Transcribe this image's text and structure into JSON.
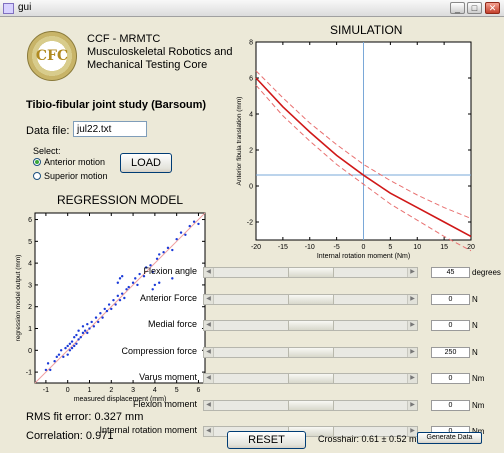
{
  "window": {
    "title": "gui"
  },
  "org": {
    "logo_text": "CFC",
    "line1": "CCF - MRMTC",
    "line2": "Musculoskeletal Robotics and",
    "line3": "Mechanical Testing Core"
  },
  "study_title": "Tibio-fibular joint study (Barsoum)",
  "data_file": {
    "label": "Data file:",
    "value": "jul22.txt"
  },
  "select": {
    "label": "Select:",
    "options": [
      {
        "label": "Anterior motion",
        "selected": true
      },
      {
        "label": "Superior motion",
        "selected": false
      }
    ]
  },
  "buttons": {
    "load": "LOAD",
    "reset": "RESET",
    "generate": "Generate Data"
  },
  "regression": {
    "heading": "REGRESSION MODEL",
    "rms_label": "RMS fit error:  0.327 mm",
    "correlation_label": "Correlation: 0.971"
  },
  "simulation": {
    "heading": "SIMULATION"
  },
  "sliders": [
    {
      "label": "Flexion angle",
      "value": "45",
      "unit": "degrees",
      "position": 0.5
    },
    {
      "label": "Anterior Force",
      "value": "0",
      "unit": "N",
      "position": 0.5
    },
    {
      "label": "Medial force",
      "value": "0",
      "unit": "N",
      "position": 0.5
    },
    {
      "label": "Compression force",
      "value": "250",
      "unit": "N",
      "position": 0.5
    },
    {
      "label": "Varus moment",
      "value": "0",
      "unit": "Nm",
      "position": 0.5
    },
    {
      "label": "Flexion moment",
      "value": "0",
      "unit": "Nm",
      "position": 0.5
    },
    {
      "label": "Internal rotation moment",
      "value": "0",
      "unit": "Nm",
      "position": 0.5
    }
  ],
  "crosshair": {
    "text": "Crosshair:  0.61 ±   0.52 mm"
  },
  "colors": {
    "scatter": "#1a3ad8",
    "fit_line": "#f0a0a0",
    "sim_main": "#d01818",
    "sim_band": "#e87070",
    "crosshair": "#7aa8d8"
  },
  "chart_data": [
    {
      "type": "scatter",
      "title": "",
      "xlabel": "measured displacement (mm)",
      "ylabel": "regression model output (mm)",
      "xlim": [
        -1.5,
        6.3
      ],
      "ylim": [
        -1.5,
        6.3
      ],
      "xticks": [
        "-1",
        "0",
        "1",
        "2",
        "3",
        "4",
        "5",
        "6"
      ],
      "yticks": [
        "-1",
        "0",
        "1",
        "2",
        "3",
        "4",
        "5",
        "6"
      ],
      "reference_line": {
        "x": [
          -1.5,
          6.3
        ],
        "y": [
          -1.5,
          6.3
        ]
      },
      "points": [
        [
          -1.0,
          -0.9
        ],
        [
          -0.9,
          -0.6
        ],
        [
          -0.8,
          -0.9
        ],
        [
          -0.6,
          -0.5
        ],
        [
          -0.5,
          -0.3
        ],
        [
          -0.4,
          -0.2
        ],
        [
          -0.3,
          0.0
        ],
        [
          -0.2,
          -0.3
        ],
        [
          -0.1,
          0.1
        ],
        [
          0.0,
          0.2
        ],
        [
          0.0,
          -0.2
        ],
        [
          0.1,
          0.3
        ],
        [
          0.1,
          0.0
        ],
        [
          0.2,
          0.4
        ],
        [
          0.2,
          0.1
        ],
        [
          0.3,
          0.2
        ],
        [
          0.3,
          0.6
        ],
        [
          0.4,
          0.3
        ],
        [
          0.4,
          0.7
        ],
        [
          0.5,
          0.5
        ],
        [
          0.5,
          0.9
        ],
        [
          0.6,
          0.6
        ],
        [
          0.7,
          0.8
        ],
        [
          0.7,
          1.1
        ],
        [
          0.8,
          0.9
        ],
        [
          0.9,
          1.2
        ],
        [
          0.9,
          0.8
        ],
        [
          1.0,
          1.0
        ],
        [
          1.1,
          1.3
        ],
        [
          1.2,
          1.1
        ],
        [
          1.3,
          1.5
        ],
        [
          1.4,
          1.3
        ],
        [
          1.5,
          1.7
        ],
        [
          1.6,
          1.5
        ],
        [
          1.7,
          1.9
        ],
        [
          1.8,
          1.8
        ],
        [
          1.9,
          2.1
        ],
        [
          2.0,
          1.9
        ],
        [
          2.1,
          2.3
        ],
        [
          2.2,
          2.1
        ],
        [
          2.3,
          2.5
        ],
        [
          2.4,
          2.3
        ],
        [
          2.5,
          2.6
        ],
        [
          2.6,
          2.4
        ],
        [
          2.7,
          2.8
        ],
        [
          2.8,
          2.9
        ],
        [
          3.0,
          3.1
        ],
        [
          3.1,
          3.3
        ],
        [
          3.2,
          3.0
        ],
        [
          3.3,
          3.5
        ],
        [
          3.5,
          3.4
        ],
        [
          3.6,
          3.8
        ],
        [
          3.8,
          3.9
        ],
        [
          3.9,
          3.6
        ],
        [
          4.1,
          4.2
        ],
        [
          4.2,
          4.4
        ],
        [
          4.4,
          4.5
        ],
        [
          4.6,
          4.7
        ],
        [
          4.8,
          4.6
        ],
        [
          5.0,
          5.1
        ],
        [
          5.2,
          5.4
        ],
        [
          5.4,
          5.3
        ],
        [
          5.6,
          5.7
        ],
        [
          5.8,
          5.9
        ],
        [
          6.0,
          5.8
        ],
        [
          2.3,
          3.1
        ],
        [
          2.4,
          3.3
        ],
        [
          2.5,
          3.4
        ],
        [
          3.9,
          2.8
        ],
        [
          4.0,
          3.0
        ],
        [
          4.2,
          3.1
        ],
        [
          4.8,
          3.3
        ]
      ]
    },
    {
      "type": "line",
      "title": "",
      "xlabel": "Internal rotation moment (Nm)",
      "ylabel": "Anterior fibula translation (mm)",
      "xlim": [
        -20,
        20
      ],
      "ylim": [
        -3,
        8
      ],
      "xticks": [
        "-20",
        "-15",
        "-10",
        "-5",
        "0",
        "5",
        "10",
        "15",
        "20"
      ],
      "yticks": [
        "-2",
        "0",
        "2",
        "4",
        "6",
        "8"
      ],
      "crosshair": {
        "x": 0,
        "y": 0.61
      },
      "series": [
        {
          "x": [
            -20,
            -15,
            -10,
            -5,
            0,
            5,
            10,
            15,
            20
          ],
          "y": [
            6.0,
            4.4,
            3.0,
            1.7,
            0.6,
            -0.4,
            -1.2,
            -2.0,
            -2.8
          ],
          "style": "solid"
        },
        {
          "x": [
            -20,
            -15,
            -10,
            -5,
            0,
            5,
            10,
            15,
            20
          ],
          "y": [
            6.4,
            4.9,
            3.5,
            2.3,
            1.2,
            0.3,
            -0.5,
            -1.2,
            -1.8
          ],
          "style": "dashed"
        },
        {
          "x": [
            -20,
            -15,
            -10,
            -5,
            0,
            5,
            10,
            15,
            20
          ],
          "y": [
            5.6,
            3.9,
            2.5,
            1.2,
            0.1,
            -1.0,
            -1.9,
            -2.8,
            -3.6
          ],
          "style": "dashed"
        }
      ]
    }
  ]
}
